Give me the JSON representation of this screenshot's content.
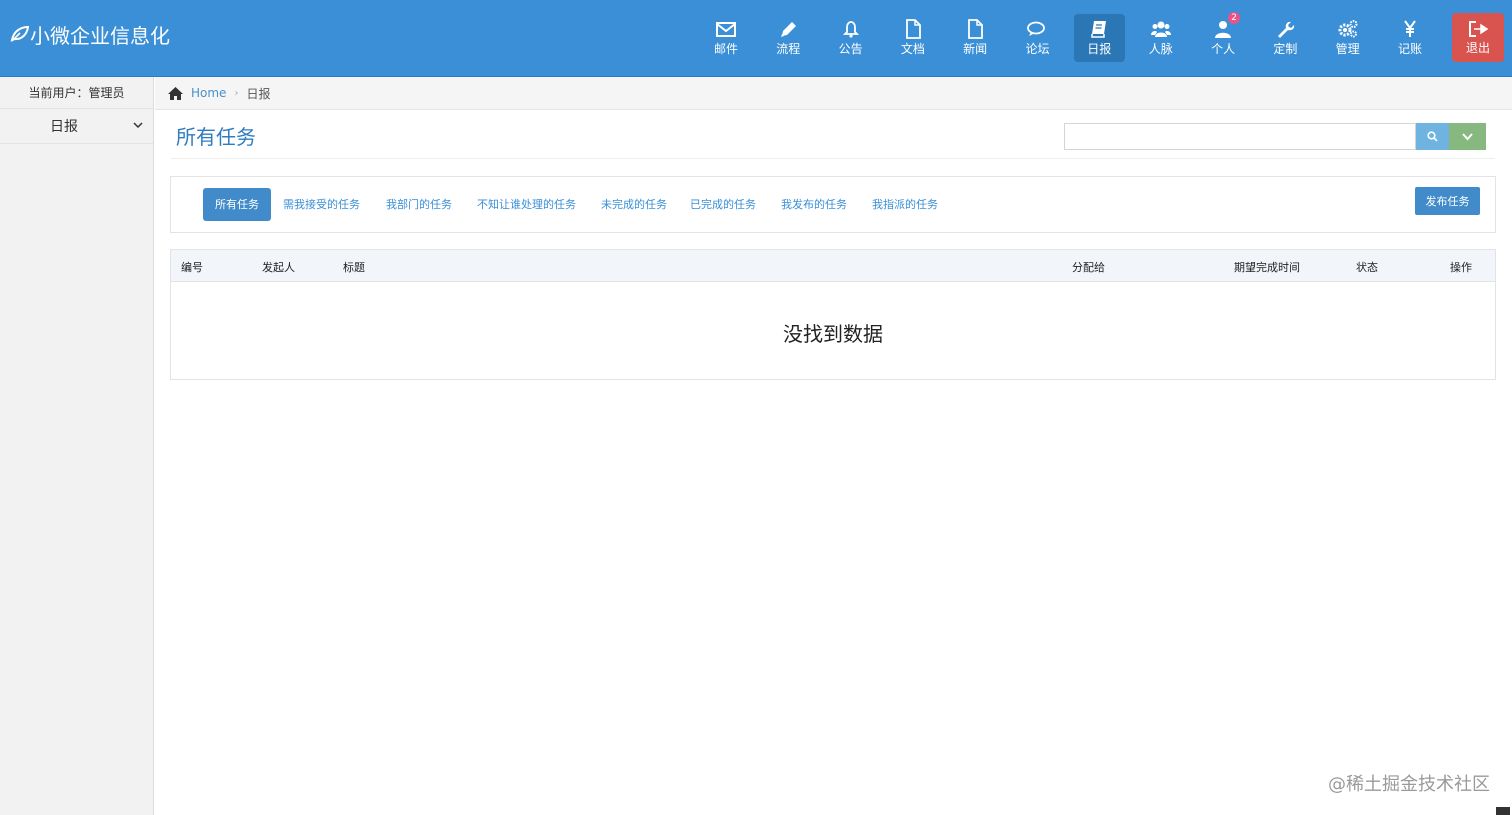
{
  "brand": {
    "title": "小微企业信息化",
    "logo_icon": "leaf-icon"
  },
  "nav": {
    "items": [
      {
        "label": "邮件",
        "icon": "mail-icon"
      },
      {
        "label": "流程",
        "icon": "pencil-icon"
      },
      {
        "label": "公告",
        "icon": "bell-icon"
      },
      {
        "label": "文档",
        "icon": "file-icon"
      },
      {
        "label": "新闻",
        "icon": "file-icon"
      },
      {
        "label": "论坛",
        "icon": "comments-icon"
      },
      {
        "label": "日报",
        "icon": "book-icon",
        "active": true
      },
      {
        "label": "人脉",
        "icon": "users-icon"
      },
      {
        "label": "个人",
        "icon": "user-icon",
        "badge": "2"
      },
      {
        "label": "定制",
        "icon": "wrench-icon"
      },
      {
        "label": "管理",
        "icon": "gears-icon"
      },
      {
        "label": "记账",
        "icon": "yen-icon"
      }
    ],
    "logout_label": "退出"
  },
  "sidebar": {
    "current_user": "当前用户：管理员",
    "menu_label": "日报"
  },
  "breadcrumb": {
    "home": "Home",
    "current": "日报"
  },
  "page": {
    "title": "所有任务",
    "search_placeholder": ""
  },
  "tabs": [
    {
      "label": "所有任务",
      "active": true
    },
    {
      "label": "需我接受的任务"
    },
    {
      "label": "我部门的任务"
    },
    {
      "label": "不知让谁处理的任务"
    },
    {
      "label": "未完成的任务"
    },
    {
      "label": "已完成的任务"
    },
    {
      "label": "我发布的任务"
    },
    {
      "label": "我指派的任务"
    }
  ],
  "publish_label": "发布任务",
  "table": {
    "headers": [
      "编号",
      "发起人",
      "标题",
      "分配给",
      "期望完成时间",
      "状态",
      "操作"
    ],
    "empty_text": "没找到数据"
  },
  "watermark": "@稀土掘金技术社区",
  "colors": {
    "navbar": "#3a8fd6",
    "logout": "#d9534f",
    "accent": "#428bca",
    "green": "#87b87f"
  }
}
